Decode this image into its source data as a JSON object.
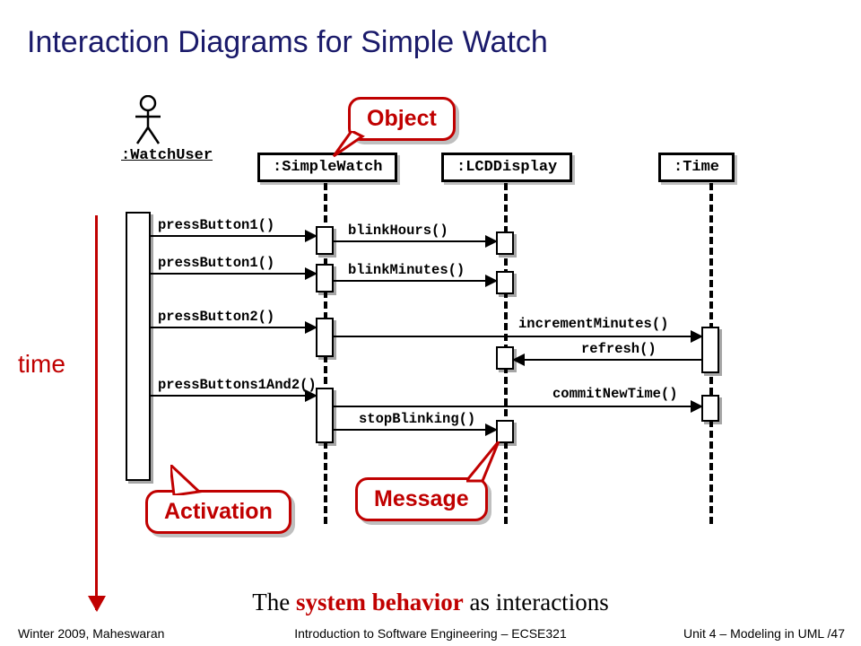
{
  "title": "Interaction Diagrams for Simple Watch",
  "footer": {
    "left": "Winter 2009, Maheswaran",
    "center": "Introduction to Software Engineering – ECSE321",
    "right": "Unit 4 – Modeling in UML  /47"
  },
  "actor": {
    "label": ":WatchUser"
  },
  "lifelines": {
    "simpleWatch": ":SimpleWatch",
    "lcdDisplay": ":LCDDisplay",
    "time": ":Time"
  },
  "messages": {
    "m1": "pressButton1()",
    "m2": "pressButton1()",
    "m3": "pressButton2()",
    "m4": "pressButtons1And2()",
    "m5": "blinkHours()",
    "m6": "blinkMinutes()",
    "m7": "incrementMinutes()",
    "m8": "refresh()",
    "m9": "commitNewTime()",
    "m10": "stopBlinking()"
  },
  "callouts": {
    "object": "Object",
    "activation": "Activation",
    "message": "Message"
  },
  "timeLabel": "time",
  "caption": {
    "pre": "The ",
    "hl": "system behavior",
    "post": " as interactions"
  }
}
